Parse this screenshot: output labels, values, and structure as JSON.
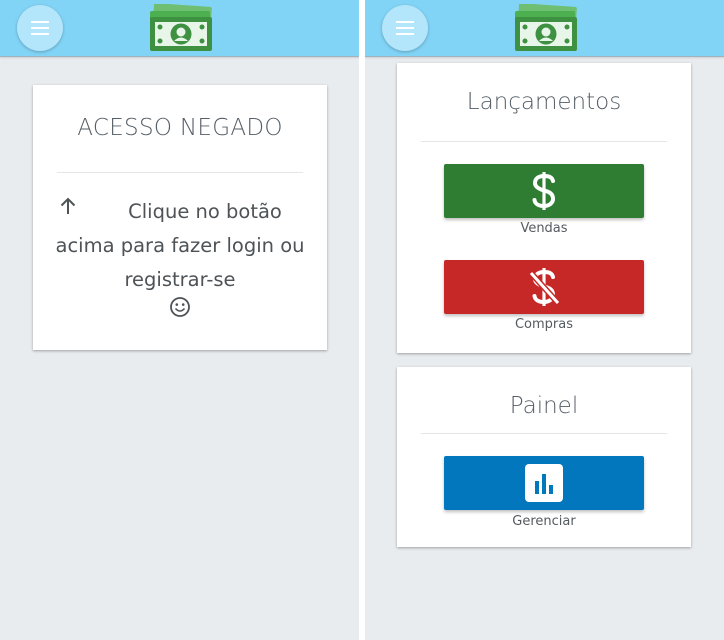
{
  "colors": {
    "appbar": "#82d4f7",
    "background": "#e9ecef",
    "sales_button": "#2e7d32",
    "purchases_button": "#c62828",
    "manage_button": "#0277bd"
  },
  "left_screen": {
    "menu_icon": "hamburger-menu-icon",
    "logo_icon": "money-bill-logo",
    "denied_card": {
      "title": "ACESSO NEGADO",
      "arrow_icon": "arrow-up-icon",
      "message": "Clique no botão acima para fazer login ou registrar-se",
      "emoji_icon": "smiley-face-icon"
    }
  },
  "right_screen": {
    "menu_icon": "hamburger-menu-icon",
    "logo_icon": "money-bill-logo",
    "launches_card": {
      "title": "Lançamentos",
      "sales_label": "Vendas",
      "sales_icon": "dollar-sign-icon",
      "purchases_label": "Compras",
      "purchases_icon": "dollar-sign-off-icon"
    },
    "panel_card": {
      "title": "Painel",
      "manage_label": "Gerenciar",
      "manage_icon": "bar-chart-icon"
    }
  }
}
